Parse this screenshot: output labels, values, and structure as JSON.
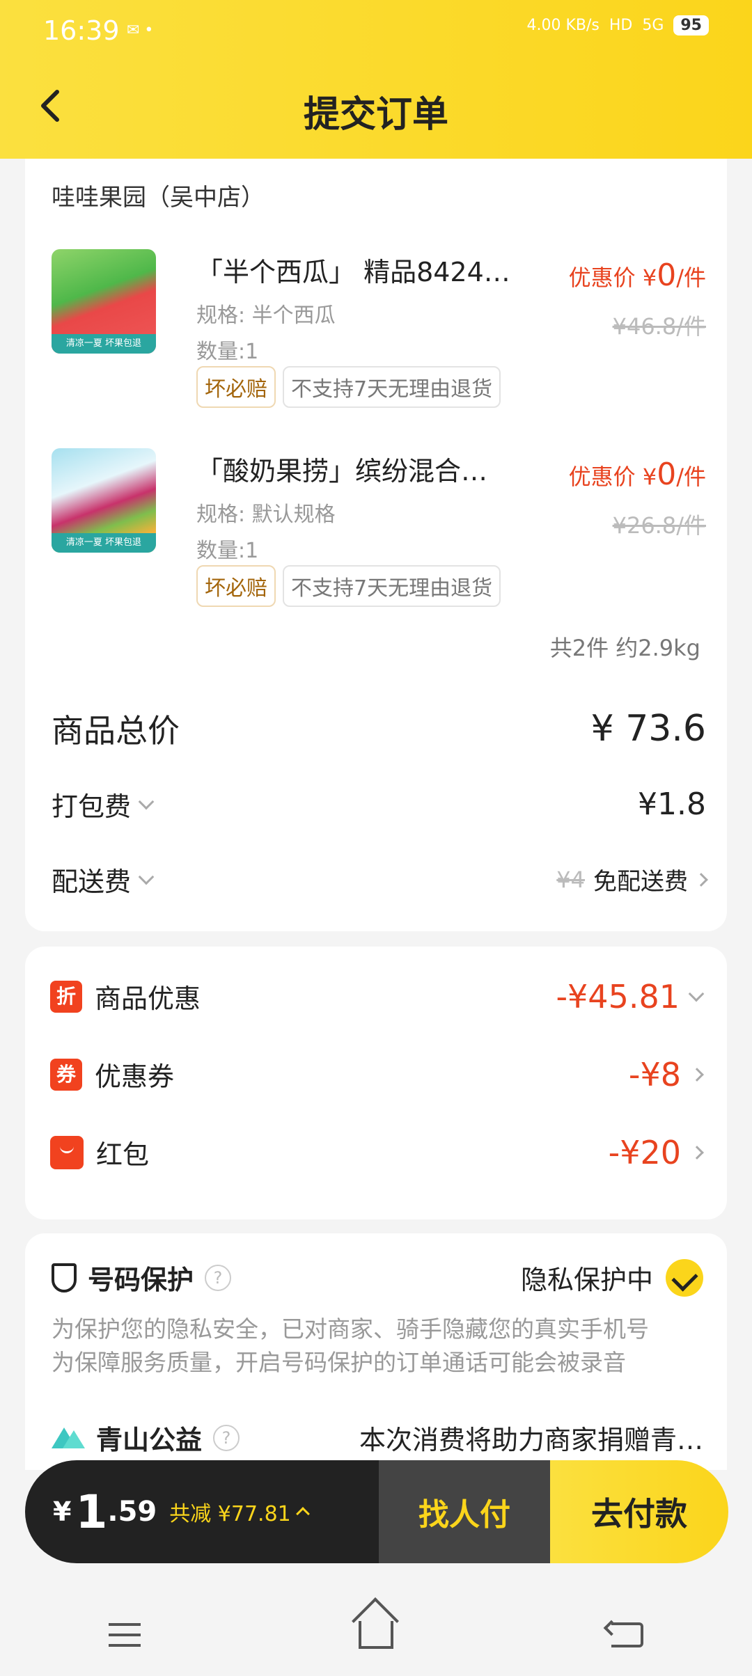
{
  "status_bar": {
    "time": "16:39",
    "dot": "✉ •",
    "network_speed": "4.00 KB/s",
    "hd": "HD",
    "signal": "5G",
    "battery": "95"
  },
  "header": {
    "title": "提交订单",
    "back_icon": "back-arrow-icon"
  },
  "store": {
    "name": "哇哇果园（吴中店）"
  },
  "items": [
    {
      "name": "「半个西瓜」 精品8424…",
      "spec": "规格: 半个西瓜",
      "qty": "数量:1",
      "tag1": "坏必赔",
      "tag2": "不支持7天无理由退货",
      "promo_label": "优惠价 ¥",
      "promo_value": "0",
      "promo_unit": "/件",
      "original": "¥46.8/件",
      "thumb_banner": "清凉一夏 坏果包退"
    },
    {
      "name": "「酸奶果捞」缤纷混合…",
      "spec": "规格: 默认规格",
      "qty": "数量:1",
      "tag1": "坏必赔",
      "tag2": "不支持7天无理由退货",
      "promo_label": "优惠价 ¥",
      "promo_value": "0",
      "promo_unit": "/件",
      "original": "¥26.8/件",
      "thumb_banner": "清凉一夏 坏果包退"
    }
  ],
  "summary": "共2件 约2.9kg",
  "totals": {
    "goods_label": "商品总价",
    "goods_value": "¥ 73.6",
    "packing_label": "打包费",
    "packing_value": "¥1.8",
    "delivery_label": "配送费",
    "delivery_original": "¥4",
    "delivery_value": "免配送费"
  },
  "discounts": {
    "goods_badge": "折",
    "goods_label": "商品优惠",
    "goods_value": "-¥45.81",
    "coupon_badge": "券",
    "coupon_label": "优惠券",
    "coupon_value": "-¥8",
    "redpack_label": "红包",
    "redpack_value": "-¥20"
  },
  "protection": {
    "label": "号码保护",
    "help": "?",
    "status": "隐私保护中",
    "line1": "为保护您的隐私安全，已对商家、骑手隐藏您的真实手机号",
    "line2": "为保障服务质量，开启号码保护的订单通话可能会被录音"
  },
  "charity": {
    "label": "青山公益",
    "help": "?",
    "text": "本次消费将助力商家捐赠青…"
  },
  "paybar": {
    "yen": "¥",
    "amount_int": "1",
    "amount_dec": ".59",
    "saved": "共减 ¥77.81",
    "friend_pay": "找人付",
    "pay": "去付款"
  },
  "colors": {
    "brand_yellow": "#fbd51b",
    "discount_red": "#e8431f"
  }
}
